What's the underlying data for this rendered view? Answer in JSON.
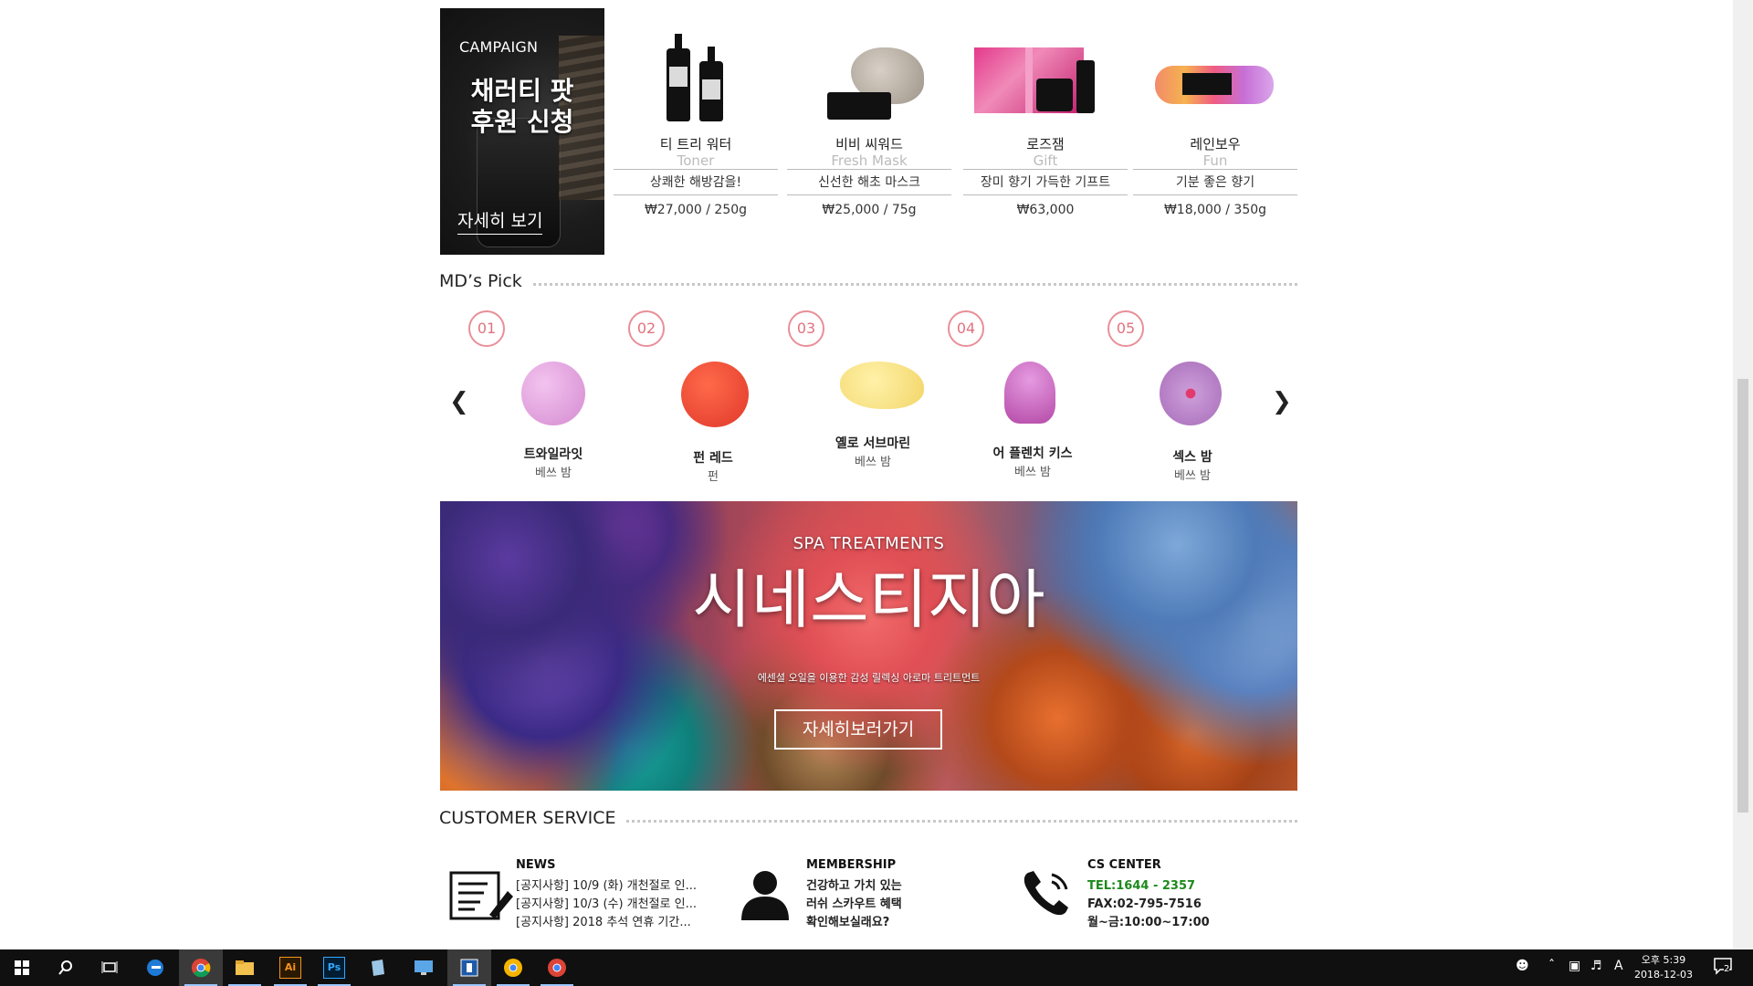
{
  "campaign": {
    "tag": "CAMPAIGN",
    "title_line1": "채러티 팟",
    "title_line2": "후원 신청",
    "link": "자세히 보기"
  },
  "products": [
    {
      "name": "티 트리 워터",
      "sub": "Toner",
      "tag": "상쾌한 해방감을!",
      "price": "₩27,000 / 250g"
    },
    {
      "name": "비비 씨워드",
      "sub": "Fresh Mask",
      "tag": "신선한 해초 마스크",
      "price": "₩25,000 / 75g"
    },
    {
      "name": "로즈잼",
      "sub": "Gift",
      "tag": "장미 향기 가득한 기프트",
      "price": "₩63,000"
    },
    {
      "name": "레인보우",
      "sub": "Fun",
      "tag": "기분 좋은 향기",
      "price": "₩18,000 / 350g"
    }
  ],
  "mds_pick": {
    "title": "MD’s Pick",
    "prev": "❮",
    "next": "❯",
    "items": [
      {
        "num": "01",
        "name": "트와일라잇",
        "sub": "베쓰 밤"
      },
      {
        "num": "02",
        "name": "펀 레드",
        "sub": "펀"
      },
      {
        "num": "03",
        "name": "옐로 서브마린",
        "sub": "베쓰 밤"
      },
      {
        "num": "04",
        "name": "어 플렌치 키스",
        "sub": "베쓰 밤"
      },
      {
        "num": "05",
        "name": "섹스 밤",
        "sub": "베쓰 밤"
      }
    ]
  },
  "spa": {
    "label": "SPA TREATMENTS",
    "title": "시네스티지아",
    "desc": "에센셜 오일을 이용한 감성 릴렉싱 아로마 트리트먼트",
    "button": "자세히보러가기"
  },
  "customer_service": {
    "title": "CUSTOMER SERVICE",
    "news": {
      "head": "NEWS",
      "items": [
        "[공지사항] 10/9 (화) 개천절로 인...",
        "[공지사항] 10/3 (수) 개천절로 인...",
        "[공지사항] 2018 추석 연휴 기간..."
      ]
    },
    "membership": {
      "head": "MEMBERSHIP",
      "lines": [
        "건강하고 가치 있는",
        "러쉬 스카우트 혜택",
        "확인해보실래요?"
      ]
    },
    "cs_center": {
      "head": "CS CENTER",
      "tel": "TEL:1644 - 2357",
      "fax": "FAX:02-795-7516",
      "hours": "월~금:10:00~17:00"
    }
  },
  "taskbar": {
    "time": "오후 5:39",
    "date": "2018-12-03",
    "ime": "A",
    "notif_count": "2",
    "apps": [
      "start-icon",
      "search-icon",
      "task-view-icon",
      "edge-icon",
      "chrome-icon",
      "file-explorer-icon",
      "illustrator-icon",
      "photoshop-icon",
      "notepad-icon",
      "remote-desktop-icon",
      "app-icon",
      "chrome-icon",
      "chrome-icon"
    ],
    "app_labels": {
      "illustrator": "Ai",
      "photoshop": "Ps"
    }
  },
  "colors": {
    "accent_pink": "#e98f98",
    "tel_green": "#1c8a1c",
    "taskbar_bg": "#101010"
  }
}
